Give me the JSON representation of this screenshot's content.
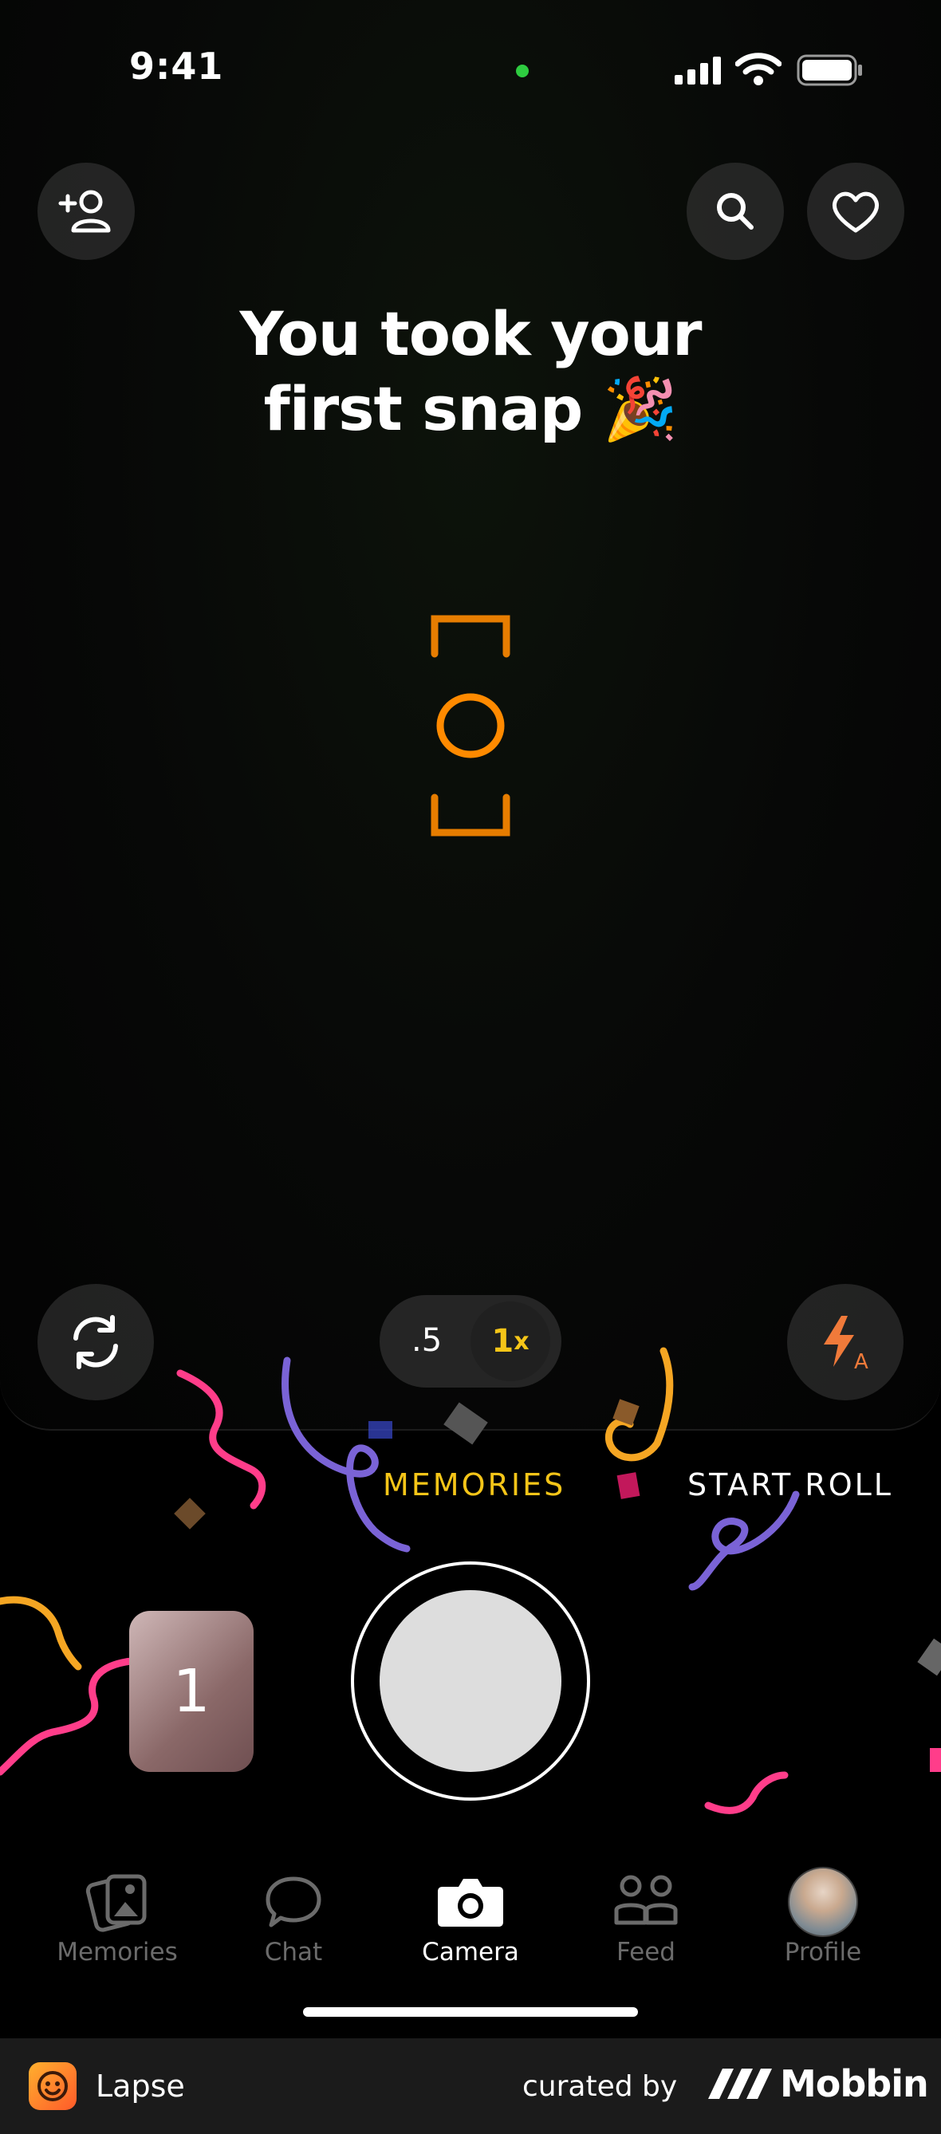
{
  "status_bar": {
    "time": "9:41"
  },
  "headline": {
    "line1": "You took your",
    "line2": "first snap 🎉"
  },
  "zoom": {
    "half": ".5",
    "one": "1",
    "one_suffix": "x"
  },
  "modes": [
    "MEMORIES",
    "START ROLL"
  ],
  "memory_count": "1",
  "tabs": [
    {
      "label": "Memories",
      "icon": "memories-icon"
    },
    {
      "label": "Chat",
      "icon": "chat-icon"
    },
    {
      "label": "Camera",
      "icon": "camera-icon",
      "active": true
    },
    {
      "label": "Feed",
      "icon": "feed-icon"
    },
    {
      "label": "Profile",
      "icon": "avatar"
    }
  ],
  "footer": {
    "app_name": "Lapse",
    "curated_by": "curated by",
    "brand": "Mobbin"
  },
  "colors": {
    "accent": "#f5c518",
    "focus": "#ff8a00",
    "flash": "#f07a3a",
    "inactive_tab": "#6b6b6b"
  }
}
